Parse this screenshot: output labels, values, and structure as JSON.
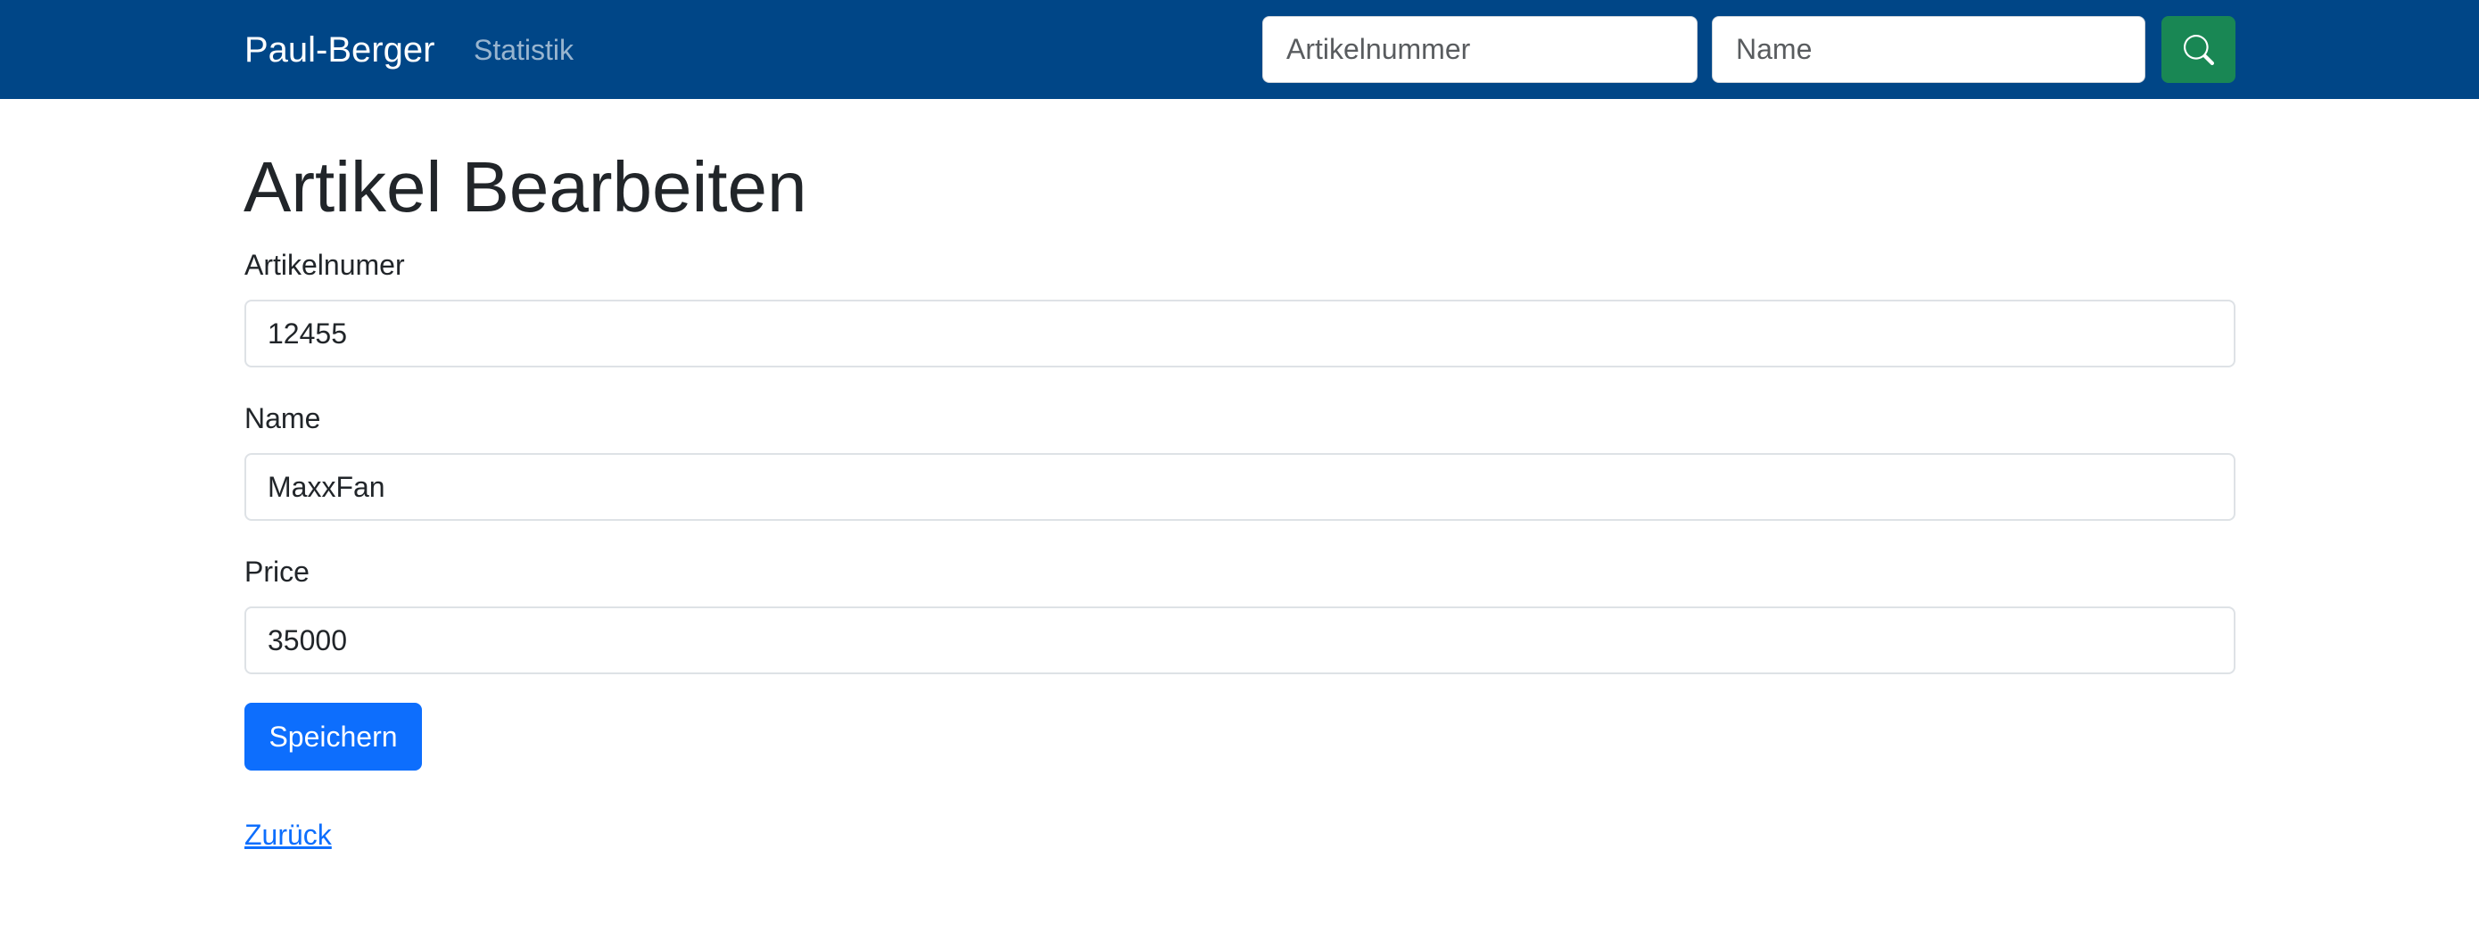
{
  "navbar": {
    "brand": "Paul-Berger",
    "links": [
      {
        "label": "Statistik"
      }
    ],
    "search": {
      "artikelnummer_placeholder": "Artikelnummer",
      "name_placeholder": "Name",
      "button_icon": "search-icon"
    },
    "colors": {
      "background": "#004687",
      "search_button": "#198754"
    }
  },
  "page": {
    "title": "Artikel Bearbeiten"
  },
  "form": {
    "fields": [
      {
        "label": "Artikelnumer",
        "value": "12455"
      },
      {
        "label": "Name",
        "value": "MaxxFan"
      },
      {
        "label": "Price",
        "value": "35000"
      }
    ],
    "save_label": "Speichern",
    "save_color": "#0d6efd"
  },
  "back_link": "Zurück"
}
